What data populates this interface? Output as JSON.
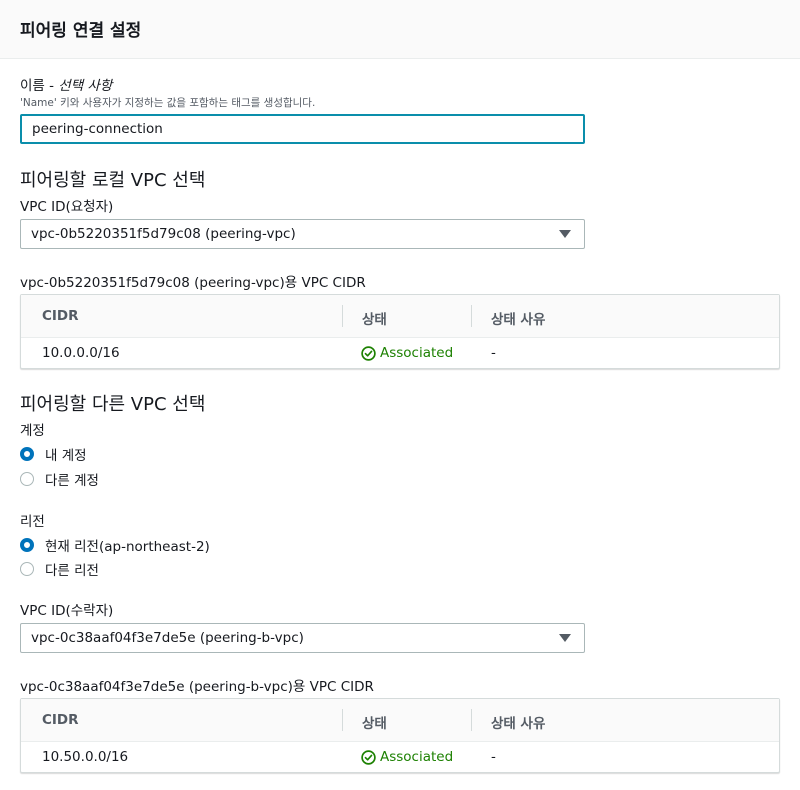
{
  "header": {
    "title": "피어링 연결 설정"
  },
  "name_field": {
    "label": "이름 - ",
    "optional": "선택 사항",
    "hint": "'Name' 키와 사용자가 지정하는 값을 포함하는 태그를 생성합니다.",
    "value": "peering-connection"
  },
  "local_vpc": {
    "section_title": "피어링할 로컬 VPC 선택",
    "vpc_label": "VPC ID(요청자)",
    "vpc_selected": "vpc-0b5220351f5d79c08 (peering-vpc)",
    "cidr_caption": "vpc-0b5220351f5d79c08 (peering-vpc)용 VPC CIDR",
    "table": {
      "columns": [
        "CIDR",
        "상태",
        "상태 사유"
      ],
      "rows": [
        {
          "cidr": "10.0.0.0/16",
          "status": "Associated",
          "reason": "-"
        }
      ]
    }
  },
  "other_vpc": {
    "section_title": "피어링할 다른 VPC 선택",
    "account_label": "계정",
    "account_options": [
      {
        "label": "내 계정",
        "checked": true
      },
      {
        "label": "다른 계정",
        "checked": false
      }
    ],
    "region_label": "리전",
    "region_options": [
      {
        "label": "현재 리전(ap-northeast-2)",
        "checked": true
      },
      {
        "label": "다른 리전",
        "checked": false
      }
    ],
    "vpc_label": "VPC ID(수락자)",
    "vpc_selected": "vpc-0c38aaf04f3e7de5e (peering-b-vpc)",
    "cidr_caption": "vpc-0c38aaf04f3e7de5e (peering-b-vpc)용 VPC CIDR",
    "table": {
      "columns": [
        "CIDR",
        "상태",
        "상태 사유"
      ],
      "rows": [
        {
          "cidr": "10.50.0.0/16",
          "status": "Associated",
          "reason": "-"
        }
      ]
    }
  },
  "colors": {
    "accent": "#0073bb",
    "focus": "#0a8eab",
    "success": "#1d8102"
  },
  "icons": {
    "status": "check-circle-icon",
    "dropdown": "caret-down-icon"
  }
}
